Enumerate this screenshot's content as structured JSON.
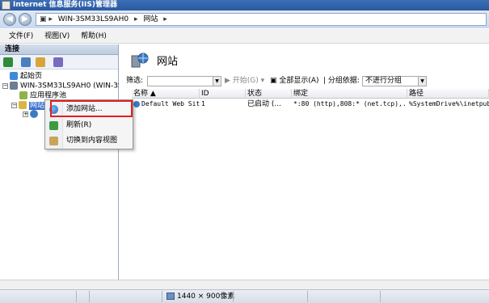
{
  "window": {
    "title": "Internet 信息服务(IIS)管理器"
  },
  "address": {
    "crumbs": [
      "WIN-3SM33LS9AH0",
      "网站"
    ],
    "separator": "▸"
  },
  "menu": {
    "items": [
      "文件(F)",
      "视图(V)",
      "帮助(H)"
    ]
  },
  "connections": {
    "header": "连接",
    "tree": {
      "start_page": "起始页",
      "server": "WIN-3SM33LS9AH0 (WIN-3SM33",
      "app_pools": "应用程序池",
      "sites_node": "网站",
      "sites_node_partial": "网"
    }
  },
  "main": {
    "title": "网站",
    "filter_label": "筛选:",
    "start_label": "开始(G)",
    "show_all_label": "全部显示(A)",
    "group_label": "分组依据:",
    "group_value": "不进行分组",
    "columns": [
      "名称",
      "ID",
      "状态",
      "绑定",
      "路径"
    ],
    "rows": [
      {
        "name": "Default Web Site",
        "id": "1",
        "status": "已启动 (...",
        "binding": "*:80 (http),808:* (net.tcp),...",
        "path": "%SystemDrive%\\inetpub\\w"
      }
    ]
  },
  "context_menu": {
    "items": [
      {
        "label": "添加网站...",
        "icon": "add-site-icon"
      },
      {
        "label": "刷新(R)",
        "icon": "refresh-icon"
      },
      {
        "label": "切换到内容视图",
        "icon": "content-view-icon"
      }
    ]
  },
  "taskbar": {
    "resolution": "1440 × 900像素"
  },
  "colors": {
    "accent": "#2a5aa0",
    "highlight": "#e02020",
    "selection": "#3a6fd0"
  }
}
